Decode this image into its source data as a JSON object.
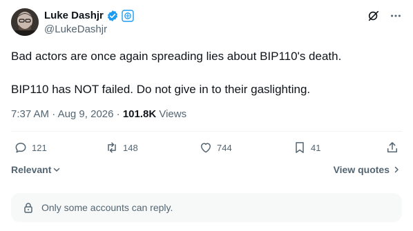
{
  "author": {
    "display_name": "Luke Dashjr",
    "handle": "@LukeDashjr"
  },
  "tweet": {
    "paragraphs": [
      "Bad actors are once again spreading lies about BIP110's death.",
      "BIP110 has NOT failed. Do not give in to their gaslighting."
    ]
  },
  "meta": {
    "time": "7:37 AM",
    "sep1": " · ",
    "date": "Aug 9, 2026",
    "sep2": " · ",
    "views_count": "101.8K",
    "views_label": " Views"
  },
  "actions": {
    "replies": "121",
    "reposts": "148",
    "likes": "744",
    "bookmarks": "41"
  },
  "sort": {
    "relevant_label": "Relevant",
    "view_quotes_label": "View quotes"
  },
  "reply_restriction": {
    "text": "Only some accounts can reply."
  },
  "icons": {
    "verified": "verified-badge-icon",
    "affiliate": "affiliate-badge-icon",
    "grok": "grok-icon",
    "more": "more-icon",
    "reply": "reply-icon",
    "repost": "repost-icon",
    "like": "heart-icon",
    "bookmark": "bookmark-icon",
    "share": "share-icon",
    "lock": "lock-icon"
  },
  "colors": {
    "text": "#0f1419",
    "muted": "#536471",
    "verified_blue": "#1d9bf0",
    "reply_box_bg": "#f7f9f9"
  }
}
